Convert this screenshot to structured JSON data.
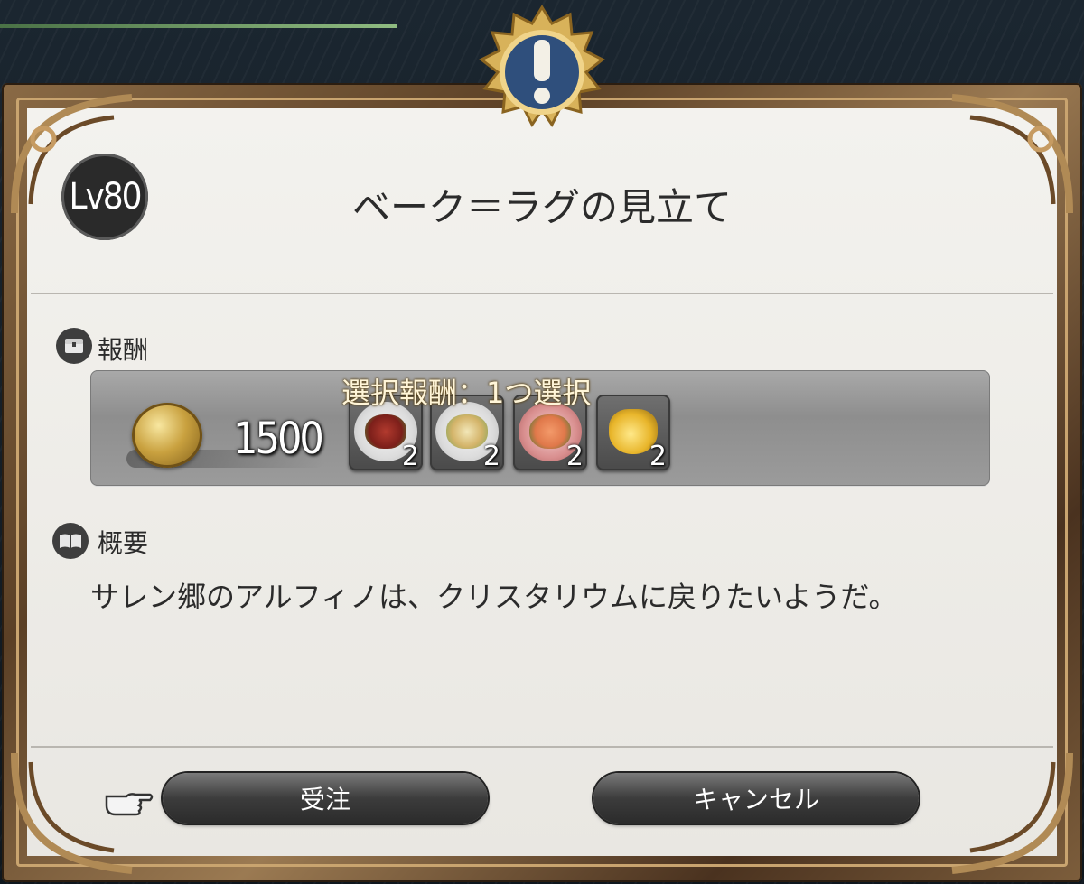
{
  "quest": {
    "level_badge": "Lv80",
    "title": "ベーク＝ラグの見立て"
  },
  "rewards": {
    "section_label": "報酬",
    "gil_amount": "1500",
    "select_label": "選択報酬：1つ選択",
    "items": [
      {
        "icon": "meat-dish-icon",
        "qty": "2"
      },
      {
        "icon": "soup-dish-icon",
        "qty": "2"
      },
      {
        "icon": "salmon-dish-icon",
        "qty": "2"
      },
      {
        "icon": "gil-bag-icon",
        "qty": "2"
      }
    ]
  },
  "overview": {
    "section_label": "概要",
    "text": "サレン郷のアルフィノは、クリスタリウムに戻りたいようだ。"
  },
  "buttons": {
    "accept_label": "受注",
    "cancel_label": "キャンセル"
  },
  "colors": {
    "panel": "#efede9",
    "frame": "#7d5e3c",
    "button": "#3c3c3c",
    "emblem_gold": "#d8b25a",
    "emblem_blue": "#2f4f7c"
  }
}
